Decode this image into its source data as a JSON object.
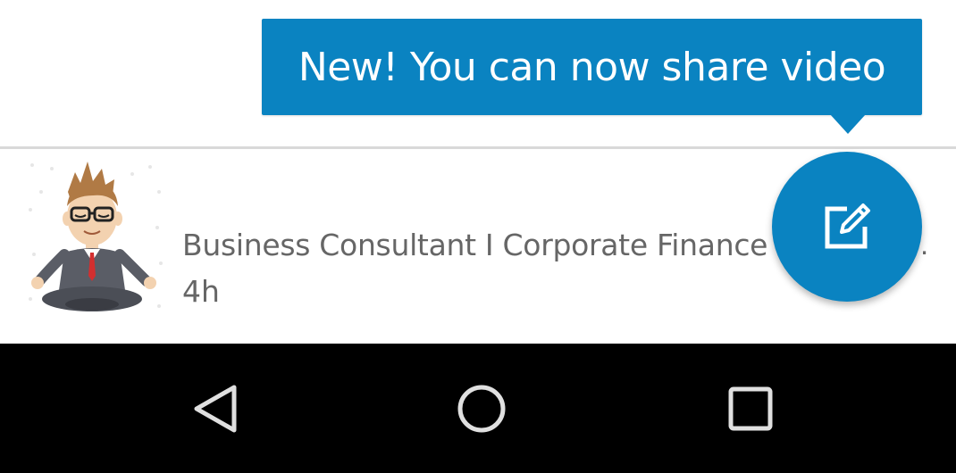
{
  "tooltip": {
    "text": "New! You can now share video"
  },
  "feed": {
    "item": {
      "subtitle": "Business Consultant I  Corporate Finance",
      "subtitle_truncation": ".",
      "time": "4h",
      "avatar_icon": "meditating-businessman-avatar"
    }
  },
  "fab": {
    "icon": "compose-icon",
    "color": "#0a83c1"
  },
  "navbar": {
    "back_icon": "back-triangle-icon",
    "home_icon": "home-circle-icon",
    "recents_icon": "recents-square-icon"
  },
  "colors": {
    "accent": "#0a83c1",
    "secondary_text": "#666666",
    "divider": "#d9d9d9",
    "navbar": "#000000"
  }
}
